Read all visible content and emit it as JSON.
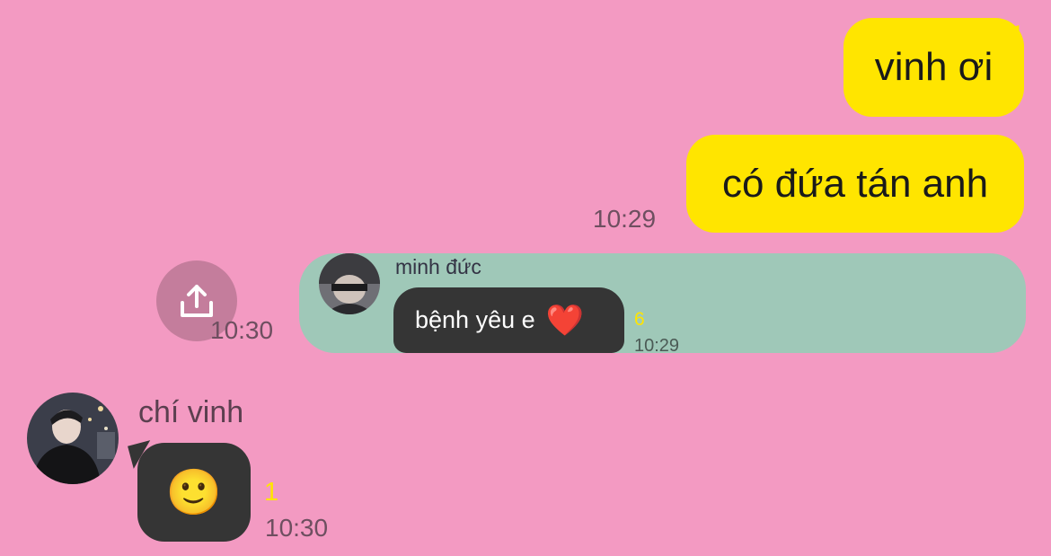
{
  "colors": {
    "background": "#f39ac2",
    "outgoing_bubble": "#ffe500",
    "shared_card": "#9fc8b8",
    "dark_bubble": "#353535",
    "unread_count": "#ffe500"
  },
  "messages": {
    "outgoing": [
      {
        "text": "vinh ơi"
      },
      {
        "text": "có đứa tán anh",
        "time": "10:29"
      }
    ],
    "shared": {
      "sender": "minh đức",
      "text": "bệnh yêu e",
      "emoji": "❤️",
      "count": "6",
      "time": "10:29",
      "share_time": "10:30",
      "share_icon": "upload-share-icon"
    },
    "incoming": {
      "name": "chí vinh",
      "emoji": "🙂",
      "count": "1",
      "time": "10:30"
    }
  }
}
